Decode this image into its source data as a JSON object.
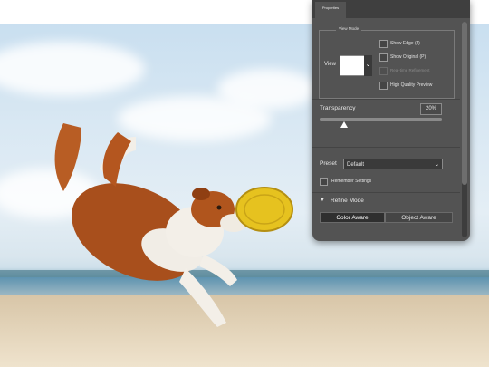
{
  "panel": {
    "tab_label": "Properties",
    "view_mode": {
      "title": "View Mode",
      "view_label": "View",
      "options": [
        {
          "label": "Show Edge (J)",
          "checked": false,
          "enabled": true
        },
        {
          "label": "Show Original (P)",
          "checked": false,
          "enabled": true
        },
        {
          "label": "Real-time Refinement",
          "checked": true,
          "enabled": false
        },
        {
          "label": "High Quality Preview",
          "checked": false,
          "enabled": true
        }
      ]
    },
    "transparency": {
      "label": "Transparency",
      "value": "20%",
      "level": 0.2
    },
    "preset": {
      "label": "Preset",
      "value": "Default"
    },
    "remember_label": "Remember Settings",
    "refine_mode": {
      "label": "Refine Mode",
      "buttons": [
        "Color Aware",
        "Object Aware"
      ],
      "active": "Color Aware"
    }
  },
  "colors": {
    "panel_bg": "#535353",
    "panel_text": "#e8e8e8",
    "frisbee": "#e6c21f"
  }
}
